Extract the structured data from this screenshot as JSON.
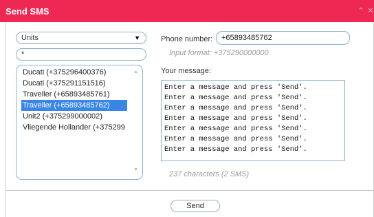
{
  "window": {
    "title": "Send SMS",
    "controls": [
      "collapse-icon",
      "close-icon"
    ]
  },
  "units": {
    "selected": "Units",
    "filter_value": "*",
    "items": [
      {
        "label": "Ducati (+375296400376)",
        "selected": false
      },
      {
        "label": "Ducati (+375291151516)",
        "selected": false
      },
      {
        "label": "Traveller (+65893485761)",
        "selected": false
      },
      {
        "label": "Traveller (+65893485762)",
        "selected": true
      },
      {
        "label": "Unit2 (+375299000002)",
        "selected": false
      },
      {
        "label": "Vliegende Hollander (+375299",
        "selected": false
      }
    ]
  },
  "phone": {
    "label": "Phone number:",
    "value": "+65893485762",
    "hint": "Input format: +375290000000"
  },
  "message": {
    "label": "Your message:",
    "lines": [
      "Enter a message and press 'Send'.",
      "Enter a message and press 'Send'.",
      "Enter a message and press 'Send'.",
      "Enter a message and press 'Send'.",
      "Enter a message and press 'Send'.",
      "Enter a message and press 'Send'.",
      "Enter a message and press 'Send'."
    ],
    "counter": "237 characters (2 SMS)"
  },
  "footer": {
    "send_label": "Send"
  },
  "colors": {
    "titlebar": "#ee2753",
    "selection": "#3a86e6",
    "field_border": "#8fb0c8"
  }
}
